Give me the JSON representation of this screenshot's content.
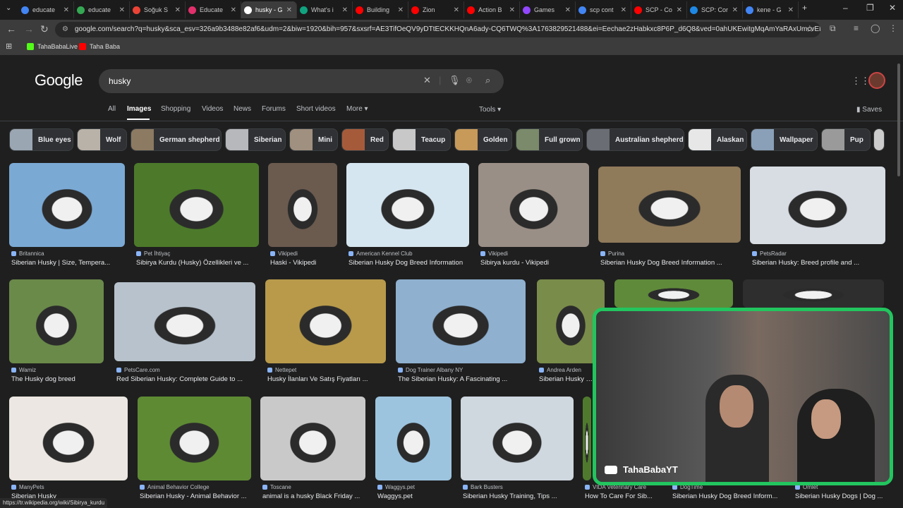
{
  "browser": {
    "tabs": [
      {
        "title": "educate",
        "color": "#4285f4"
      },
      {
        "title": "educate",
        "color": "#34a853"
      },
      {
        "title": "Soğuk S",
        "color": "#ea4335"
      },
      {
        "title": "Educate",
        "color": "#e1306c"
      },
      {
        "title": "husky - G",
        "color": "#ffffff"
      },
      {
        "title": "What's i",
        "color": "#10a37f"
      },
      {
        "title": "Building",
        "color": "#ff0000"
      },
      {
        "title": "Zion",
        "color": "#ff0000"
      },
      {
        "title": "Action B",
        "color": "#ff0000"
      },
      {
        "title": "Games",
        "color": "#9146ff"
      },
      {
        "title": "scp cont",
        "color": "#4285f4"
      },
      {
        "title": "SCP - Co",
        "color": "#ff0000"
      },
      {
        "title": "SCP: Cor",
        "color": "#1e88e5"
      },
      {
        "title": "kene - G",
        "color": "#4285f4"
      }
    ],
    "active_tab": 4,
    "url": "google.com/search?q=husky&sca_esv=326a9b3488e82af6&udm=2&biw=1920&bih=957&sxsrf=AE3TifOeQV9yDTtECKKHQnA6ady-CQ6TWQ%3A1763829521488&ei=Eechae2zHabkxc8P6P_d6Q8&ved=0ahUKEwitgMqAmYaRAxUmcvEDHeh_N_...",
    "bookmarks": [
      {
        "label": "TahaBabaLive",
        "color": "#53fc18"
      },
      {
        "label": "Taha Baba",
        "color": "#ff0000"
      }
    ],
    "status_url": "https://tr.wikipedia.org/wiki/Sibirya_kurdu"
  },
  "google": {
    "logo": "Google",
    "query": "husky",
    "menu": [
      "All",
      "Images",
      "Shopping",
      "Videos",
      "News",
      "Forums",
      "Short videos",
      "More ▾"
    ],
    "active_menu": "Images",
    "tools": "Tools ▾",
    "saves": "Saves",
    "chips": [
      "Blue eyes",
      "Wolf",
      "German shepherd",
      "Siberian",
      "Mini",
      "Red",
      "Teacup",
      "Golden",
      "Full grown",
      "Australian shepherd",
      "Alaskan",
      "Wallpaper",
      "Pup"
    ]
  },
  "results": [
    {
      "source": "Britannica",
      "title": "Siberian Husky | Size, Tempera...",
      "color": "#7aa9d4"
    },
    {
      "source": "Pet İhtiyaç",
      "title": "Sibirya Kurdu (Husky) Özellikleri ve ...",
      "color": "#4c7a2a"
    },
    {
      "source": "Vikipedi",
      "title": "Haski - Vikipedi",
      "color": "#6b5a4e"
    },
    {
      "source": "American Kennel Club",
      "title": "Siberian Husky Dog Breed Information",
      "color": "#d6e6f0"
    },
    {
      "source": "Vikipedi",
      "title": "Sibirya kurdu - Vikipedi",
      "color": "#9a8f86"
    },
    {
      "source": "Purina",
      "title": "Siberian Husky Dog Breed Information ...",
      "color": "#8f7a5a"
    },
    {
      "source": "PetsRadar",
      "title": "Siberian Husky: Breed profile and ...",
      "color": "#d8dde4"
    },
    {
      "source": "Wamiz",
      "title": "The Husky dog breed",
      "color": "#6a8a4a"
    },
    {
      "source": "PetsCare.com",
      "title": "Red Siberian Husky: Complete Guide to ...",
      "color": "#b7c2cc"
    },
    {
      "source": "Nettepet",
      "title": "Husky İlanları Ve Satış Fiyatları ...",
      "color": "#b89a4a"
    },
    {
      "source": "Dog Trainer Albany NY",
      "title": "The Siberian Husky: A Fascinating ...",
      "color": "#8fb0cf"
    },
    {
      "source": "Andrea Arden",
      "title": "Siberian Husky Do...",
      "color": "#7a8c4a"
    },
    {
      "source": "",
      "title": "",
      "color": "#5f8a3a"
    },
    {
      "source": "",
      "title": "",
      "color": "#2e2e2e"
    },
    {
      "source": "ManyPets",
      "title": "Siberian Husky",
      "color": "#ece7e2"
    },
    {
      "source": "Animal Behavior College",
      "title": "Siberian Husky - Animal Behavior ...",
      "color": "#5e8a34"
    },
    {
      "source": "Toscane",
      "title": "animal is a husky Black Friday ...",
      "color": "#c9c9c9"
    },
    {
      "source": "Waggys.pet",
      "title": "Waggys.pet",
      "color": "#9cc4df"
    },
    {
      "source": "Bark Busters",
      "title": "Siberian Husky Training, Tips ...",
      "color": "#cfd7df"
    },
    {
      "source": "VIDA Veterinary Care",
      "title": "How To Care For Sib...",
      "color": "#4f7a2e"
    },
    {
      "source": "DogTime",
      "title": "Siberian Husky Dog Breed Inform...",
      "color": "#556"
    },
    {
      "source": "Omlet",
      "title": "Siberian Husky Dogs | Dog ...",
      "color": "#445"
    }
  ],
  "overlay": {
    "channel": "TahaBabaYT",
    "border_color": "#22c55e"
  }
}
